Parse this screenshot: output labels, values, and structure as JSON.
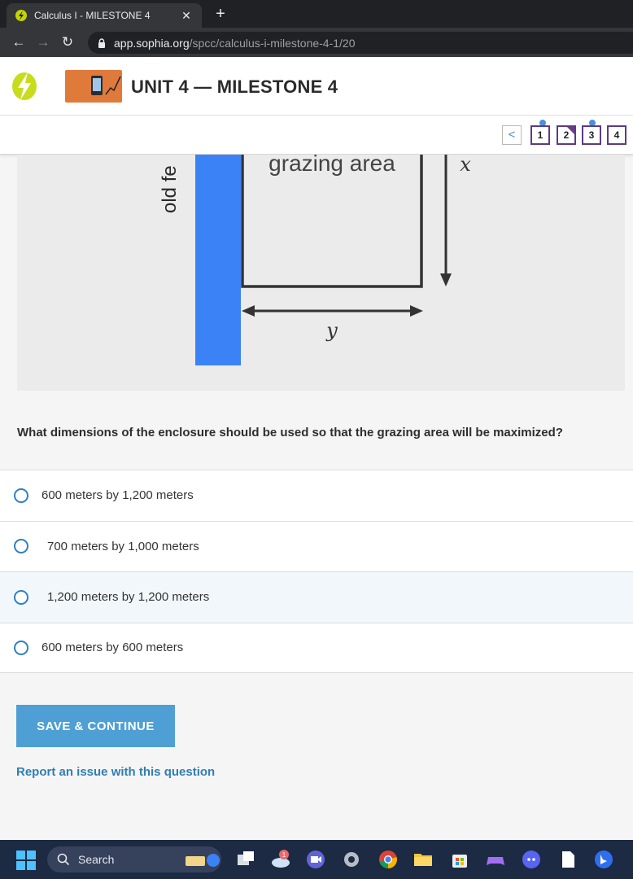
{
  "browser": {
    "tab_title": "Calculus I - MILESTONE 4",
    "tab_close": "✕",
    "new_tab": "+",
    "url_host": "app.sophia.org",
    "url_path": "/spcc/calculus-i-milestone-4-1/20"
  },
  "header": {
    "unit_title": "UNIT 4 — MILESTONE 4"
  },
  "question_nav": {
    "prev": "<",
    "numbers": [
      "1",
      "2",
      "3",
      "4"
    ]
  },
  "figure": {
    "fence_label": "old fe",
    "area_label": "grazing area",
    "x_label": "x",
    "y_label": "y"
  },
  "question": {
    "text": "What dimensions of the enclosure should be used so that the grazing area will be maximized?",
    "options": [
      "600 meters by 1,200 meters",
      "700 meters by 1,000 meters",
      "1,200 meters by 1,200 meters",
      "600 meters by 600 meters"
    ],
    "save_label": "SAVE & CONTINUE",
    "report_label": "Report an issue with this question"
  },
  "taskbar": {
    "search_label": "Search",
    "badge_count": "1"
  },
  "colors": {
    "accent": "#4e9fd4",
    "link": "#2f7fb5",
    "fence": "#3b82f6",
    "nav_border": "#5d3a82"
  }
}
